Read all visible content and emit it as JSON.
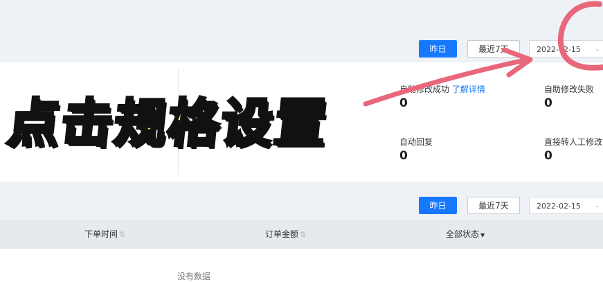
{
  "filters_top": {
    "yesterday": "昨日",
    "last7": "最近7天",
    "date_start": "2022-02-15",
    "date_sep": "-"
  },
  "stats": [
    {
      "label": "自助修改成功",
      "link": "了解详情",
      "value": "0"
    },
    {
      "label": "自助修改失败",
      "value": "0"
    },
    {
      "label": "自动回复",
      "value": "0"
    },
    {
      "label": "直接转人工修改",
      "value": "0"
    }
  ],
  "filters_bottom": {
    "yesterday": "昨日",
    "last7": "最近7天",
    "date_start": "2022-02-15",
    "date_sep": "-"
  },
  "table": {
    "columns": [
      {
        "label": "下单时间",
        "icon": "sort-icon"
      },
      {
        "label": "订单金额",
        "icon": "sort-icon"
      },
      {
        "label": "全部状态",
        "icon": "caret-down-icon"
      }
    ],
    "empty_text": "没有数据"
  },
  "overlay_caption": "点击规格设置",
  "colors": {
    "primary": "#1677ff",
    "annotation": "#e8677a",
    "caption_fill": "#ffe94a",
    "caption_outline": "#111111"
  }
}
